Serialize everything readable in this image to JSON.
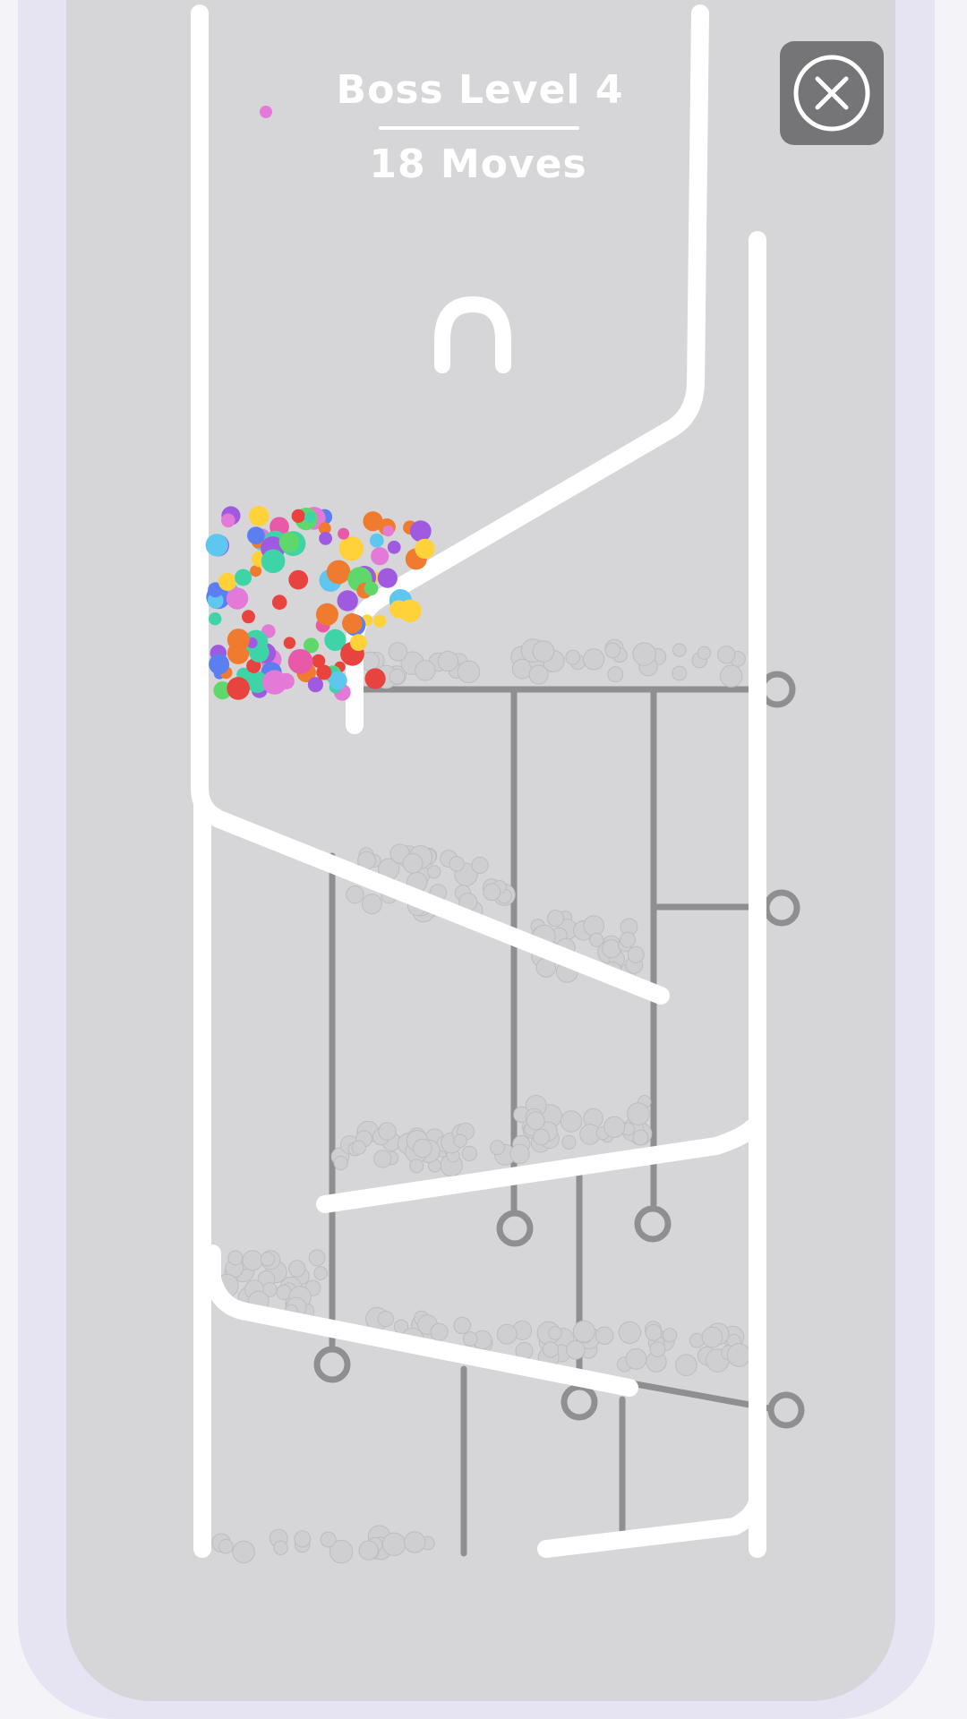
{
  "header": {
    "level_title": "Boss Level 4",
    "moves_label": "18 Moves"
  },
  "controls": {
    "close_icon": "close-icon"
  },
  "colors": {
    "board_background": "#d6d6d9",
    "frame": "#e6e4f2",
    "walls": "#ffffff",
    "pins": "#8f8f92",
    "gray_balls": "#cfcfd2",
    "colored_balls": [
      "#e8433f",
      "#f07a2e",
      "#ffd23a",
      "#5ed86a",
      "#3fd3a8",
      "#5ec7f0",
      "#5b7ff0",
      "#a05ae0",
      "#e85aa8",
      "#e37ad8"
    ]
  }
}
